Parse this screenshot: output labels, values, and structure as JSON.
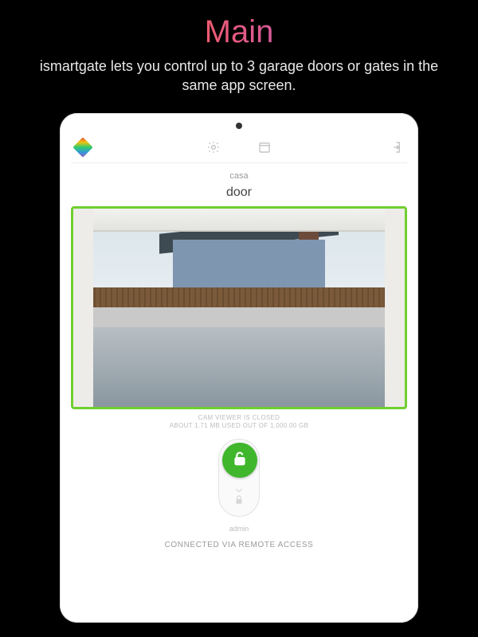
{
  "hero": {
    "title": "Main",
    "subtitle": "ismartgate lets you control up to 3 garage doors or gates in the same app screen."
  },
  "toolbar": {
    "logo": "ismartgate-logo",
    "settings": "settings",
    "calendar": "calendar",
    "exit": "exit"
  },
  "location": "casa",
  "door_name": "door",
  "cam_status": {
    "line1": "CAM VIEWER IS CLOSED",
    "line2": "ABOUT 1.71 MB USED OUT OF 1,000.00 GB"
  },
  "toggle": {
    "state": "unlocked"
  },
  "user": "admin",
  "connection": "CONNECTED VIA REMOTE ACCESS"
}
